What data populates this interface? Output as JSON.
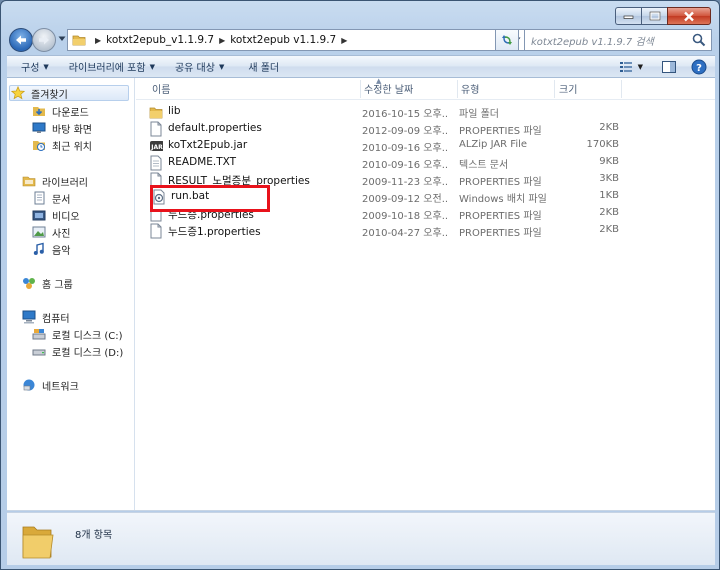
{
  "address": {
    "crumbs": [
      "kotxt2epub_v1.1.9.7",
      "kotxt2epub v1.1.9.7"
    ]
  },
  "search": {
    "placeholder": "kotxt2epub v1.1.9.7 검색"
  },
  "toolbar": {
    "organize": "구성",
    "include_library": "라이브러리에 포함",
    "share": "공유 대상",
    "new_folder": "새 폴더"
  },
  "nav": {
    "favorites": "즐겨찾기",
    "downloads": "다운로드",
    "desktop": "바탕 화면",
    "recent": "최근 위치",
    "libraries": "라이브러리",
    "documents": "문서",
    "videos": "비디오",
    "pictures": "사진",
    "music": "음악",
    "homegroup": "홈 그룹",
    "computer": "컴퓨터",
    "drive_c": "로컬 디스크 (C:)",
    "drive_d": "로컬 디스크 (D:)",
    "network": "네트워크"
  },
  "columns": {
    "name": "이름",
    "date": "수정한 날짜",
    "type": "유형",
    "size": "크기"
  },
  "files": [
    {
      "name": "lib",
      "date": "2016-10-15 오후...",
      "type": "파일 폴더",
      "size": "",
      "icon": "folder-icon"
    },
    {
      "name": "default.properties",
      "date": "2012-09-09 오후...",
      "type": "PROPERTIES 파일",
      "size": "2KB",
      "icon": "file-icon"
    },
    {
      "name": "koTxt2Epub.jar",
      "date": "2010-09-16 오후...",
      "type": "ALZip JAR File",
      "size": "170KB",
      "icon": "jar-icon"
    },
    {
      "name": "README.TXT",
      "date": "2010-09-16 오후...",
      "type": "텍스트 문서",
      "size": "9KB",
      "icon": "text-file-icon"
    },
    {
      "name": "RESULT_노멀증분_properties",
      "date": "2009-11-23 오후...",
      "type": "PROPERTIES 파일",
      "size": "3KB",
      "icon": "file-icon"
    },
    {
      "name": "run.bat",
      "date": "2009-09-12 오전...",
      "type": "Windows 배치 파일",
      "size": "1KB",
      "icon": "batch-file-icon"
    },
    {
      "name": "누드증.properties",
      "date": "2009-10-18 오후...",
      "type": "PROPERTIES 파일",
      "size": "2KB",
      "icon": "file-icon"
    },
    {
      "name": "누드증1.properties",
      "date": "2010-04-27 오후...",
      "type": "PROPERTIES 파일",
      "size": "2KB",
      "icon": "file-icon"
    }
  ],
  "details": {
    "item_count": "8개 항목"
  },
  "colors": {
    "highlight": "#e8121b"
  }
}
